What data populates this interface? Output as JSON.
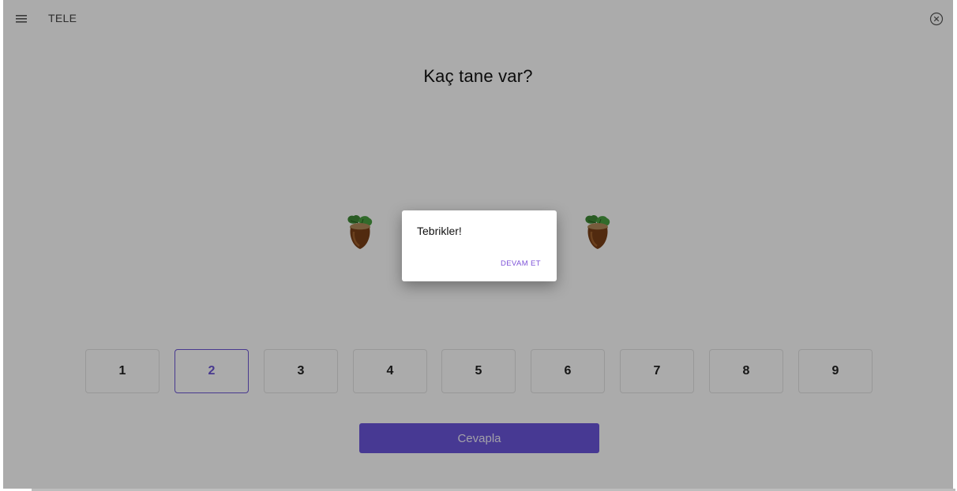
{
  "header": {
    "menu_icon": "hamburger-menu-icon",
    "title": "TELE",
    "close_icon": "close-circle-icon"
  },
  "question": "Kaç tane var?",
  "items_icon": "hazelnut-icon",
  "options": [
    "1",
    "2",
    "3",
    "4",
    "5",
    "6",
    "7",
    "8",
    "9"
  ],
  "selected_option": "2",
  "submit_label": "Cevapla",
  "dialog": {
    "message": "Tebrikler!",
    "button_label": "DEVAM ET"
  },
  "colors": {
    "accent": "#6a55dc",
    "dialog_button": "#7d52d8",
    "overlay": "rgba(0,0,0,0.33)"
  }
}
